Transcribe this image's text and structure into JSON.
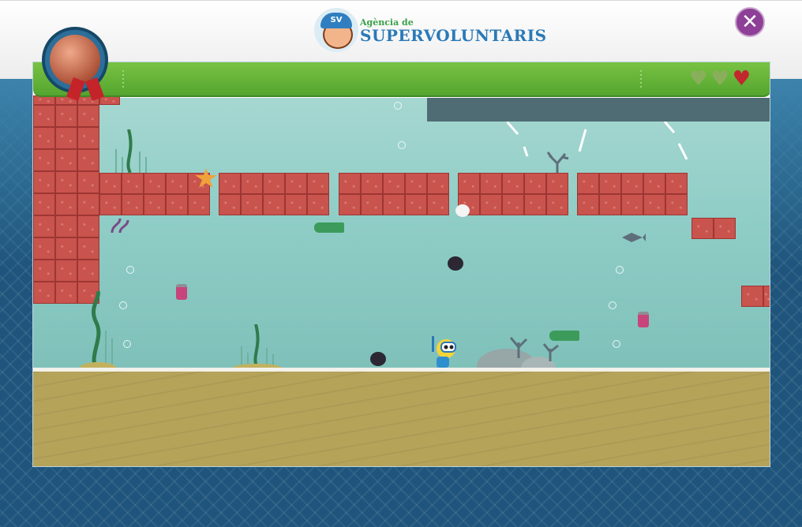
{
  "header": {
    "logo": {
      "badge_text": "SV",
      "subtitle": "Agència de",
      "title": "SUPERVOLUNTARIS"
    },
    "close_icon": "close-icon"
  },
  "hud": {
    "lives_total": 3,
    "lives_remaining": 1,
    "medal": "bronze-medal-icon"
  },
  "colors": {
    "hud_green": "#5fae36",
    "brick_red": "#c9534d",
    "water": "#8fcdc6",
    "sand": "#b5a35a",
    "close_button": "#8e3f97",
    "ocean_background": "#1f557c"
  },
  "scene": {
    "player": "diver-character",
    "items": [
      "sea-mine-icon",
      "bottle-icon",
      "can-icon",
      "fish-skeleton-icon",
      "starfish-icon",
      "coral-icon",
      "seaweed-icon"
    ]
  }
}
